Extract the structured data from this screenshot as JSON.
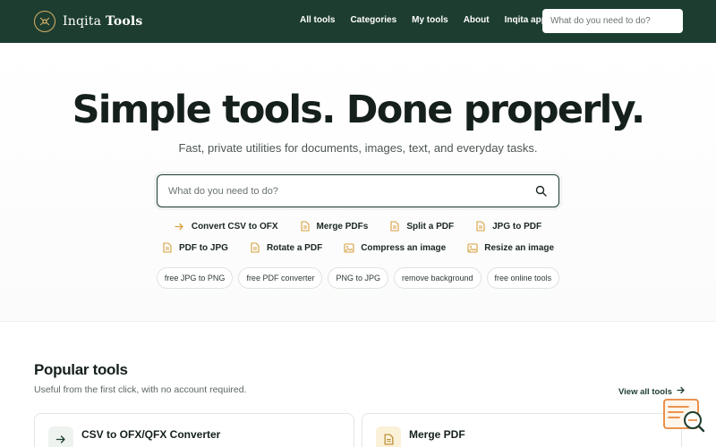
{
  "brand": {
    "name_regular": "Inqita",
    "name_bold": "Tools"
  },
  "nav": {
    "links": [
      "All tools",
      "Categories",
      "My tools",
      "About",
      "Inqita app"
    ],
    "search_placeholder": "What do you need to do?"
  },
  "hero": {
    "title": "Simple tools. Done properly.",
    "subtitle": "Fast, private utilities for documents, images, text, and everyday tasks.",
    "search_placeholder": "What do you need to do?",
    "quick_links": [
      {
        "label": "Convert CSV to OFX",
        "icon": "arrow-right-icon"
      },
      {
        "label": "Merge PDFs",
        "icon": "document-icon"
      },
      {
        "label": "Split a PDF",
        "icon": "document-icon"
      },
      {
        "label": "JPG to PDF",
        "icon": "document-icon"
      },
      {
        "label": "PDF to JPG",
        "icon": "document-icon"
      },
      {
        "label": "Rotate a PDF",
        "icon": "document-icon"
      },
      {
        "label": "Compress an image",
        "icon": "image-icon"
      },
      {
        "label": "Resize an image",
        "icon": "image-icon"
      }
    ],
    "chips": [
      "free JPG to PNG",
      "free PDF converter",
      "PNG to JPG",
      "remove background",
      "free online tools"
    ]
  },
  "popular": {
    "title": "Popular tools",
    "subtitle": "Useful from the first click, with no account required.",
    "view_all": "View all tools",
    "cards": [
      {
        "title": "CSV to OFX/QFX Converter",
        "icon": "arrow-right-icon",
        "description": ""
      },
      {
        "title": "Merge PDF",
        "icon": "document-icon",
        "description": ""
      }
    ]
  },
  "colors": {
    "header_bg": "#1d3d30",
    "accent_gold": "#d8a040",
    "text_dark": "#15201c"
  }
}
